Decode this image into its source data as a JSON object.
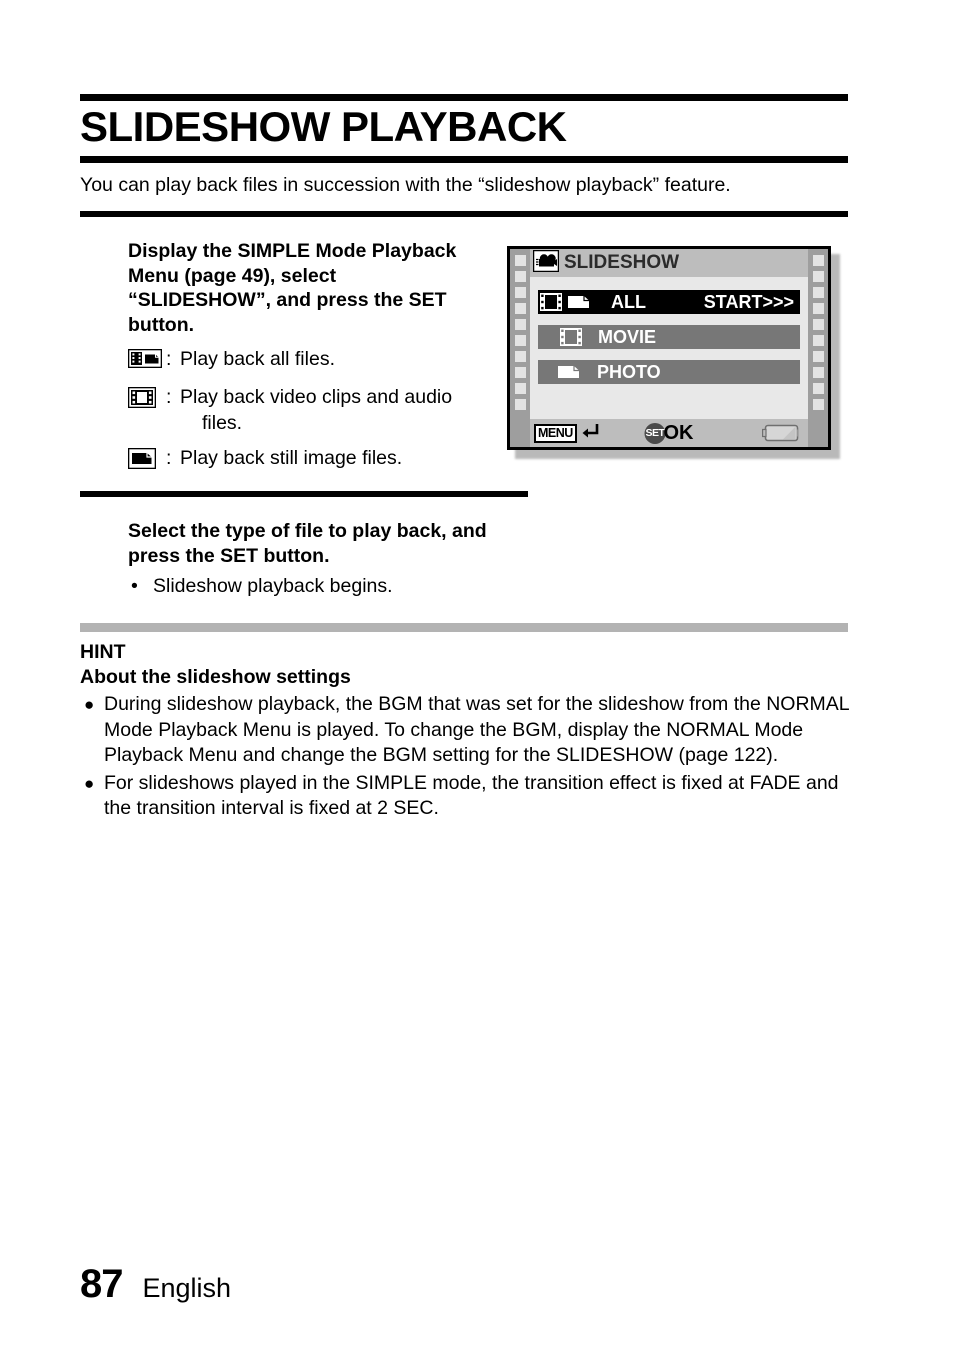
{
  "document": {
    "title": "SLIDESHOW PLAYBACK",
    "intro": "You can play back files in succession with the “slideshow playback” feature."
  },
  "steps": [
    {
      "heading": "Display the SIMPLE Mode Playback Menu (page 49), select “SLIDESHOW”, and press the SET button.",
      "icon_items": [
        {
          "icon": "film-photo-icon",
          "colon": ":",
          "text": "Play back all files.",
          "text2": ""
        },
        {
          "icon": "film-icon",
          "colon": ":",
          "text": "Play back video clips and audio",
          "text2": "files."
        },
        {
          "icon": "photo-icon",
          "colon": ":",
          "text": "Play back still image files.",
          "text2": ""
        }
      ]
    },
    {
      "heading": "Select the type of file to play back, and press the SET button.",
      "bullet_dot": "•",
      "bullet": "Slideshow playback begins."
    }
  ],
  "hint": {
    "label": "HINT",
    "subtitle": "About the slideshow settings",
    "bullet_dot": "●",
    "items": [
      "During slideshow playback, the BGM that was set for the slideshow from the NORMAL Mode Playback Menu is played. To change the BGM, display the NORMAL Mode Playback Menu and change the BGM setting for the SLIDESHOW (page 122).",
      "For slideshows played in the SIMPLE mode, the transition effect is fixed at FADE and the transition interval is fixed at 2 SEC."
    ]
  },
  "lcd": {
    "title": "SLIDESHOW",
    "title_icon": "camcorder-icon",
    "rows": [
      {
        "label": "ALL",
        "right_label": "START>>>",
        "selected": true,
        "icons": [
          "film-icon",
          "photo-icon"
        ]
      },
      {
        "label": "MOVIE",
        "right_label": "",
        "selected": false,
        "icons": [
          "film-icon"
        ]
      },
      {
        "label": "PHOTO",
        "right_label": "",
        "selected": false,
        "icons": [
          "photo-icon"
        ]
      }
    ],
    "footer": {
      "menu_label": "MENU",
      "return_icon": "return-arrow-icon",
      "set_label": "SET",
      "ok_label": "OK",
      "battery_icon": "battery-icon"
    },
    "colors": {
      "bezel": "#9e9e9e",
      "screen": "#e8e8e8",
      "titlebar": "#bdbdbd",
      "row_selected": "#000000",
      "row_normal": "#777777"
    }
  },
  "footer": {
    "page_number": "87",
    "language": "English"
  },
  "colors": {
    "rule": "#000000",
    "hint_bar": "#b3b3b3"
  }
}
